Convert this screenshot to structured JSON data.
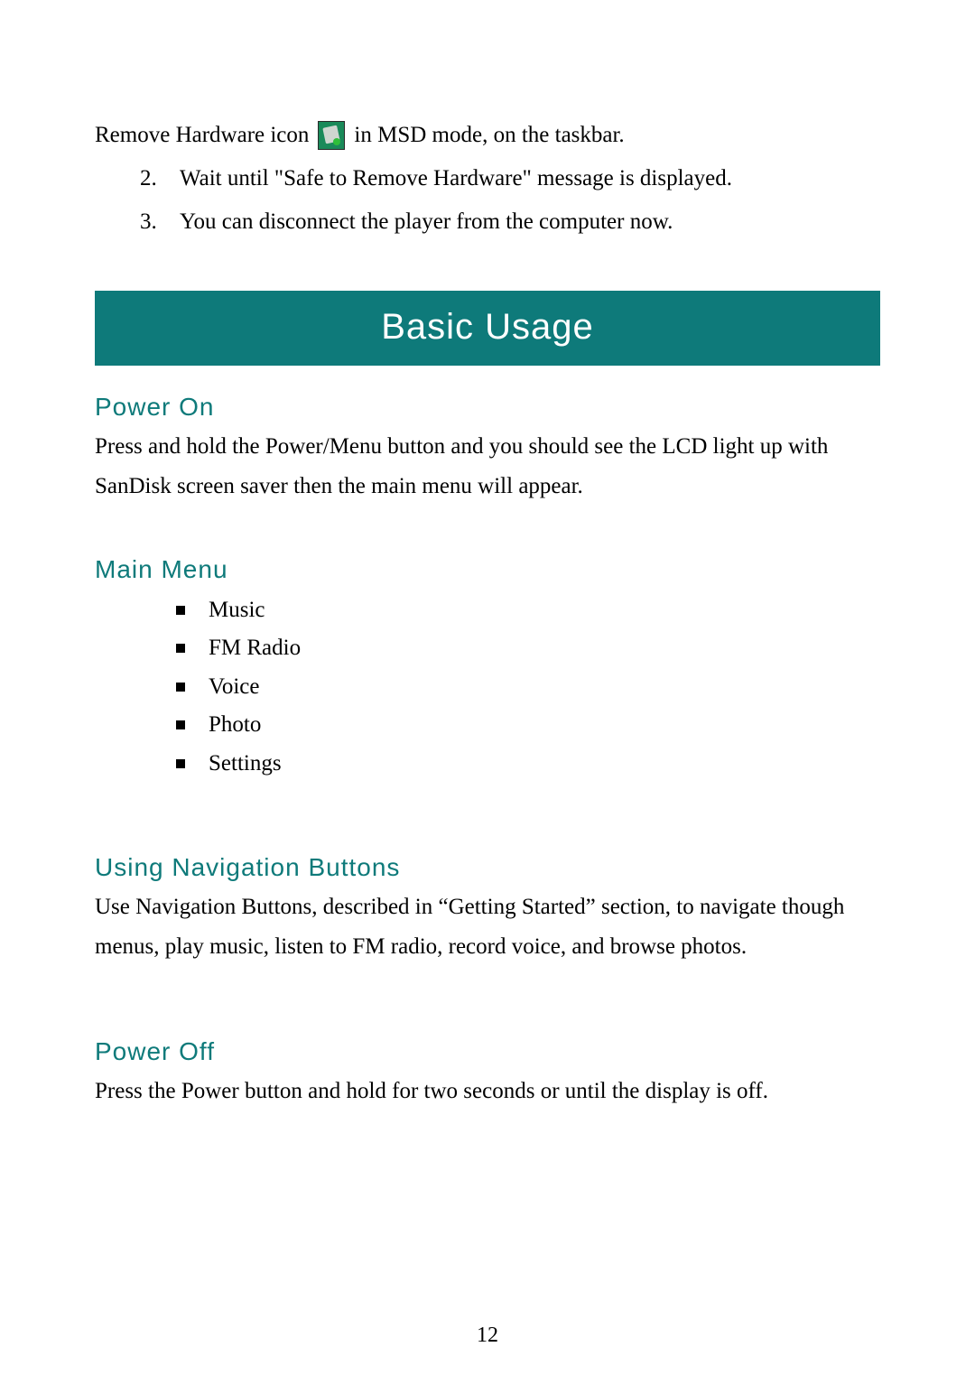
{
  "intro": {
    "line1_pre": "Remove Hardware icon",
    "line1_post": "in MSD mode, on the taskbar.",
    "icon_name": "remove-hardware-icon"
  },
  "steps": [
    {
      "num": "2.",
      "text": "Wait until \"Safe to Remove Hardware\" message is displayed."
    },
    {
      "num": "3.",
      "text": "You can disconnect the player from the computer now."
    }
  ],
  "banner": "Basic Usage",
  "sections": {
    "power_on": {
      "heading": "Power On",
      "body": "Press and hold the Power/Menu button and you should see the LCD light up with SanDisk screen saver then the main menu will appear."
    },
    "main_menu": {
      "heading": "Main Menu",
      "items": [
        "Music",
        "FM Radio",
        "Voice",
        "Photo",
        "Settings"
      ]
    },
    "nav_buttons": {
      "heading": "Using Navigation Buttons",
      "body": "Use Navigation Buttons, described in “Getting Started” section, to navigate though menus, play music, listen to FM radio, record voice, and browse photos."
    },
    "power_off": {
      "heading": "Power Off",
      "body": "Press the Power button and hold for two seconds or until the display is off."
    }
  },
  "page_number": "12",
  "colors": {
    "accent": "#0e7a7a"
  }
}
